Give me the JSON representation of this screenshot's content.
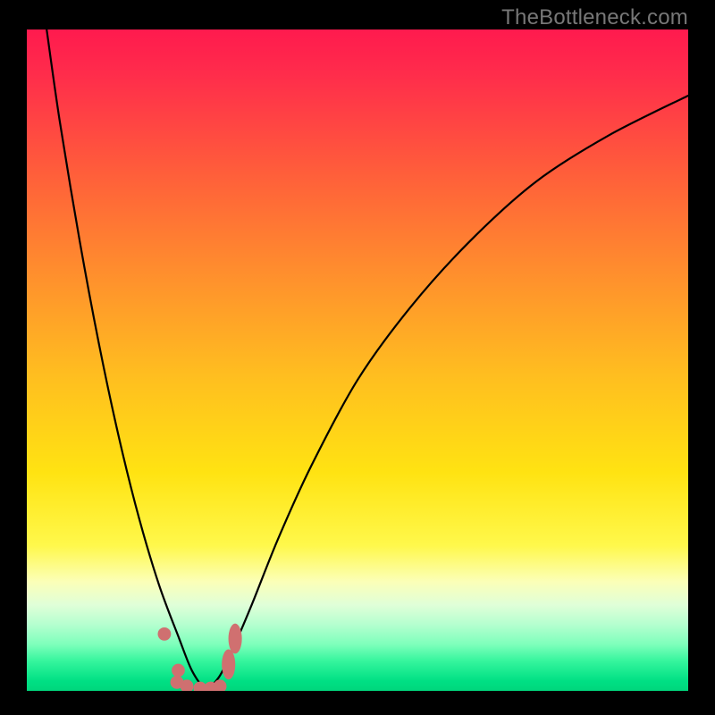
{
  "watermark": "TheBottleneck.com",
  "colors": {
    "black": "#000000",
    "gradient_stops": [
      {
        "offset": 0.0,
        "color": "#ff1a4e"
      },
      {
        "offset": 0.07,
        "color": "#ff2d4b"
      },
      {
        "offset": 0.22,
        "color": "#ff5f3a"
      },
      {
        "offset": 0.37,
        "color": "#ff8f2d"
      },
      {
        "offset": 0.52,
        "color": "#ffbd20"
      },
      {
        "offset": 0.67,
        "color": "#ffe312"
      },
      {
        "offset": 0.78,
        "color": "#fff84b"
      },
      {
        "offset": 0.835,
        "color": "#fbffb8"
      },
      {
        "offset": 0.87,
        "color": "#e0ffd8"
      },
      {
        "offset": 0.9,
        "color": "#b4ffcf"
      },
      {
        "offset": 0.93,
        "color": "#7dffbb"
      },
      {
        "offset": 0.955,
        "color": "#35f59d"
      },
      {
        "offset": 0.985,
        "color": "#00e084"
      },
      {
        "offset": 1.0,
        "color": "#00d67c"
      }
    ],
    "curve_stroke": "#000000",
    "marker": "#cf7070"
  },
  "chart_data": {
    "type": "line",
    "title": "",
    "xlabel": "",
    "ylabel": "",
    "xlim": [
      0,
      100
    ],
    "ylim": [
      0,
      100
    ],
    "series": [
      {
        "name": "bottleneck-curve",
        "description": "V-shaped bottleneck curve; minimum near x≈27 at y≈0; left branch rises steeply to top-left corner, right branch rises with diminishing slope toward upper right",
        "x": [
          3,
          5,
          8,
          11,
          14,
          17,
          20,
          23,
          25,
          27,
          29,
          31,
          34,
          38,
          43,
          50,
          58,
          67,
          77,
          88,
          100
        ],
        "y": [
          100,
          86,
          68,
          52,
          38,
          26,
          16,
          8,
          3,
          0.5,
          2,
          6,
          13,
          23,
          34,
          47,
          58,
          68,
          77,
          84,
          90
        ]
      }
    ],
    "markers": [
      {
        "x": 20.8,
        "y": 8.6,
        "shape": "dot",
        "r": 1.0
      },
      {
        "x": 22.9,
        "y": 3.1,
        "shape": "dot",
        "r": 1.0
      },
      {
        "x": 22.7,
        "y": 1.3,
        "shape": "dot",
        "r": 1.0
      },
      {
        "x": 24.2,
        "y": 0.7,
        "shape": "dot",
        "r": 1.0
      },
      {
        "x": 26.2,
        "y": 0.4,
        "shape": "dot",
        "r": 1.0
      },
      {
        "x": 27.8,
        "y": 0.4,
        "shape": "dot",
        "r": 1.0
      },
      {
        "x": 29.2,
        "y": 0.7,
        "shape": "dot",
        "r": 1.0
      },
      {
        "x": 30.5,
        "y": 4.0,
        "shape": "oblong",
        "r": 1.2
      },
      {
        "x": 31.5,
        "y": 7.9,
        "shape": "oblong",
        "r": 1.2
      }
    ]
  }
}
